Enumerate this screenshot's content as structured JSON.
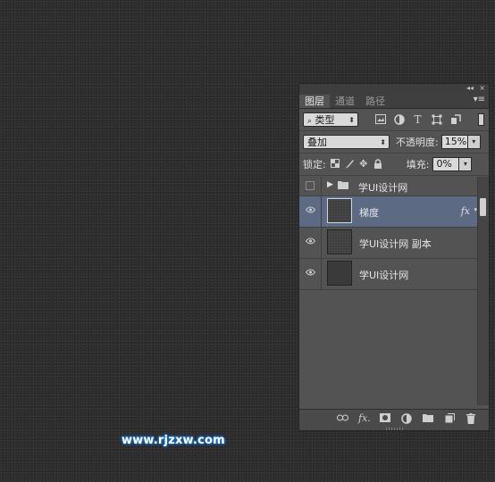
{
  "watermark": "www.rjzxw.com",
  "panel": {
    "collapse_label": "◂◂",
    "close_label": "×",
    "tabs": [
      {
        "label": "图层",
        "active": true
      },
      {
        "label": "通道",
        "active": false
      },
      {
        "label": "路径",
        "active": false
      }
    ],
    "menu_label": "▾≡",
    "filter": {
      "kind_value": "类型",
      "icons": [
        "image-filter-icon",
        "adjustment-filter-icon",
        "type-filter-icon",
        "shape-filter-icon",
        "smart-object-filter-icon"
      ]
    },
    "blend": {
      "mode_value": "叠加",
      "opacity_label": "不透明度:",
      "opacity_value": "15%"
    },
    "lock": {
      "label": "锁定:",
      "fill_label": "填充:",
      "fill_value": "0%"
    },
    "layers": [
      {
        "type": "group",
        "name": "学UI设计网",
        "visible": false
      },
      {
        "type": "layer",
        "name": "梯度",
        "selected": true,
        "has_fx": true,
        "fx_label": "fx",
        "thumb": "noise"
      },
      {
        "type": "layer",
        "name": "学UI设计网 副本",
        "selected": false,
        "thumb": "noise"
      },
      {
        "type": "layer",
        "name": "学UI设计网",
        "selected": false,
        "thumb": "plain"
      }
    ],
    "bottom_icons": [
      "link-layers-icon",
      "fx-icon",
      "mask-icon",
      "adjustment-layer-icon",
      "new-group-icon",
      "new-layer-icon",
      "delete-icon"
    ],
    "fx_bottom_label": "fx."
  }
}
